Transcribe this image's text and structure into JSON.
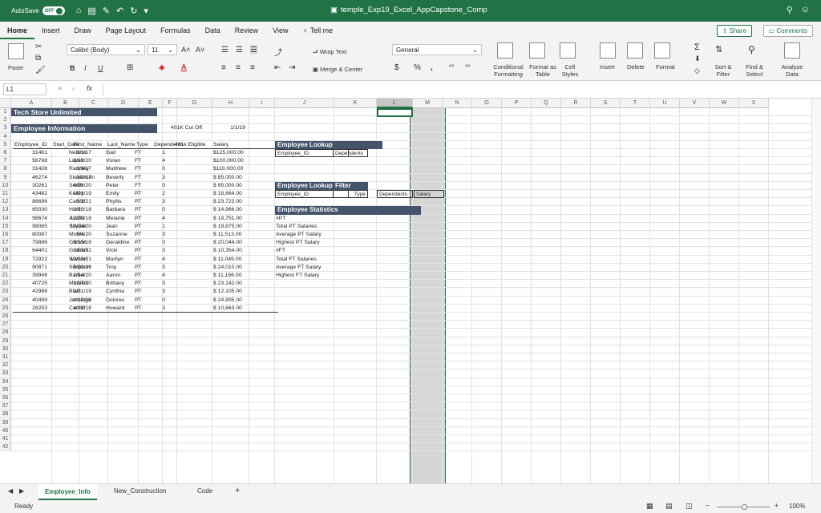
{
  "titlebar": {
    "autosave_label": "AutoSave",
    "autosave_state": "OFF",
    "doc_title": "temple_Exp19_Excel_AppCapstone_Comp"
  },
  "tabs": [
    "Home",
    "Insert",
    "Draw",
    "Page Layout",
    "Formulas",
    "Data",
    "Review",
    "View",
    "Tell me"
  ],
  "share_label": "Share",
  "comments_label": "Comments",
  "ribbon": {
    "paste": "Paste",
    "font_name": "Calibri (Body)",
    "font_size": "11",
    "wrap_text": "Wrap Text",
    "merge_center": "Merge & Center",
    "number_format": "General",
    "cond_fmt": "Conditional Formatting",
    "format_table": "Format as Table",
    "cell_styles": "Cell Styles",
    "insert": "Insert",
    "delete": "Delete",
    "format": "Format",
    "sort_filter": "Sort & Filter",
    "find_select": "Find & Select",
    "analyze": "Analyze Data",
    "bold": "B",
    "italic": "I",
    "underline": "U",
    "fx": "fx",
    "dollar": "$",
    "percent": "%",
    "comma": ","
  },
  "namebox": "L1",
  "columns": [
    "A",
    "B",
    "C",
    "D",
    "E",
    "F",
    "G",
    "H",
    "I",
    "J",
    "K",
    "L",
    "M",
    "N",
    "O",
    "P",
    "Q",
    "R",
    "S",
    "T",
    "U",
    "V",
    "W",
    "X"
  ],
  "rows": [
    "1",
    "2",
    "3",
    "4",
    "5",
    "6",
    "7",
    "8",
    "9",
    "10",
    "11",
    "12",
    "13",
    "14",
    "15",
    "16",
    "17",
    "18",
    "19",
    "20",
    "21",
    "22",
    "23",
    "24",
    "25",
    "26",
    "27",
    "28",
    "29",
    "30",
    "31",
    "32",
    "33",
    "34",
    "35",
    "36",
    "37",
    "38",
    "39",
    "40",
    "41",
    "42"
  ],
  "sheet": {
    "company": "Tech Store Unlimited",
    "section": "Employee Information",
    "cutoff_label": "401K Cut Off",
    "cutoff_date": "1/1/19",
    "headers": [
      "Employee_ID",
      "Start_Date",
      "First_Name",
      "Last_Name",
      "Type",
      "Dependents",
      "401k Eligible",
      "Salary"
    ],
    "employees": [
      [
        "31461",
        "2/1/17",
        "Nelson",
        "Gail",
        "FT",
        "1",
        "",
        "$125,000.00"
      ],
      [
        "56768",
        "8/19/20",
        "Lopez",
        "Vivian",
        "FT",
        "4",
        "",
        "$100,000.00"
      ],
      [
        "31428",
        "1/8/17",
        "Ramsey",
        "Matthew",
        "FT",
        "0",
        "",
        "$110,000.00"
      ],
      [
        "46274",
        "2/2/17",
        "Stevenson",
        "Beverly",
        "FT",
        "3",
        "",
        "$ 85,000.00"
      ],
      [
        "30261",
        "4/29/20",
        "Smith",
        "Peter",
        "FT",
        "0",
        "",
        "$ 95,000.00"
      ],
      [
        "43482",
        "1/21/19",
        "Kelley",
        "Emily",
        "PT",
        "2",
        "",
        "$ 18,864.00"
      ],
      [
        "88696",
        "5/1/21",
        "Carroll",
        "Phyllis",
        "PT",
        "3",
        "",
        "$ 23,722.00"
      ],
      [
        "65030",
        "1/28/18",
        "Hunt",
        "Barbara",
        "PT",
        "0",
        "",
        "$ 14,966.00"
      ],
      [
        "98674",
        "12/29/18",
        "Austin",
        "Melanie",
        "PT",
        "4",
        "",
        "$ 18,751.00"
      ],
      [
        "98065",
        "10/14/20",
        "Snyder",
        "Jean",
        "PT",
        "1",
        "",
        "$ 18,875.00"
      ],
      [
        "80087",
        "6/4/20",
        "Morris",
        "Suzanne",
        "PT",
        "3",
        "",
        "$ 11,513.00"
      ],
      [
        "79886",
        "6/15/18",
        "Gibson",
        "Geraldine",
        "PT",
        "0",
        "",
        "$ 20,044.00"
      ],
      [
        "64401",
        "11/3/21",
        "Graham",
        "Vicki",
        "PT",
        "3",
        "",
        "$ 10,354.00"
      ],
      [
        "72922",
        "12/15/21",
        "Watson",
        "Marilyn",
        "PT",
        "4",
        "",
        "$ 11,049.00"
      ],
      [
        "90871",
        "5/30/19",
        "Simpson",
        "Troy",
        "PT",
        "3",
        "",
        "$ 24,010.00"
      ],
      [
        "39948",
        "1/14/20",
        "Barber",
        "Aaron",
        "PT",
        "4",
        "",
        "$ 11,156.00"
      ],
      [
        "40725",
        "12/7/20",
        "Morales",
        "Brittany",
        "PT",
        "3",
        "",
        "$ 23,142.00"
      ],
      [
        "42988",
        "1/31/19",
        "Blair",
        "Cynthia",
        "PT",
        "3",
        "",
        "$ 12,105.00"
      ],
      [
        "40499",
        "4/13/18",
        "Jennings",
        "Dolores",
        "PT",
        "0",
        "",
        "$ 24,905.00"
      ],
      [
        "28253",
        "4/29/18",
        "Carroll",
        "Howard",
        "PT",
        "3",
        "",
        "$ 10,663.00"
      ]
    ],
    "lookup1_title": "Employee Lookup",
    "lookup1_id": "Employee_ID",
    "lookup1_dep": "Dependents",
    "lookup2_title": "Employee Lookup",
    "lookup2_filter": "Filter",
    "lookup2_id": "Employee_ID",
    "lookup2_type": "Type",
    "lookup2_dep": "Dependents",
    "lookup2_salary": "Salary",
    "stats_title": "Employee Statistics",
    "stats": [
      "#PT",
      "Total PT Salaries",
      "Average PT Salary",
      "Highest PT Salary",
      "#FT",
      "Total FT Salaries",
      "Average FT Salary",
      "Highest FT Salary"
    ]
  },
  "sheet_tabs": [
    "Employee_Info",
    "New_Construction",
    "Code"
  ],
  "status": {
    "ready": "Ready",
    "zoom": "100%"
  }
}
